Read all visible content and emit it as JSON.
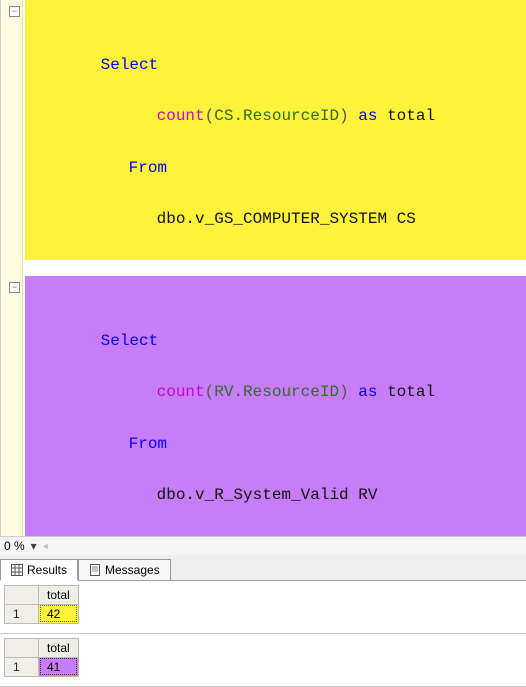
{
  "editor": {
    "queries": [
      {
        "highlight": "yellow",
        "lines": {
          "l1_kw": "Select",
          "l2_fn": "count",
          "l2_open": "(",
          "l2_arg": "CS.ResourceID",
          "l2_close": ")",
          "l2_as": " as ",
          "l2_alias": "total",
          "l3_kw": "From",
          "l4_obj": "dbo.v_GS_COMPUTER_SYSTEM CS"
        }
      },
      {
        "highlight": "purple",
        "lines": {
          "l1_kw": "Select",
          "l2_fn": "count",
          "l2_open": "(",
          "l2_arg": "RV.ResourceID",
          "l2_close": ")",
          "l2_as": " as ",
          "l2_alias": "total",
          "l3_kw": "From",
          "l4_obj": "dbo.v_R_System_Valid RV"
        }
      }
    ]
  },
  "zoom": {
    "value": "0 %"
  },
  "tabs": {
    "results": "Results",
    "messages": "Messages"
  },
  "results": [
    {
      "column": "total",
      "value": "42",
      "rownum": "1",
      "highlight": "yellow"
    },
    {
      "column": "total",
      "value": "41",
      "rownum": "1",
      "highlight": "purple"
    }
  ]
}
